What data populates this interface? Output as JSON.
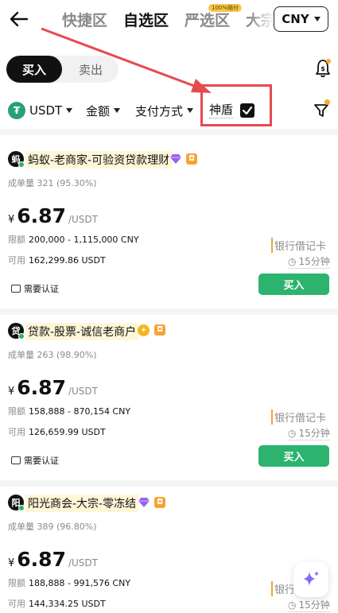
{
  "header": {
    "tabs": [
      {
        "label": "快捷区"
      },
      {
        "label": "自选区"
      },
      {
        "label": "严选区",
        "badge": "100%赔付"
      },
      {
        "label": "大宗"
      }
    ],
    "active_tab": "自选区",
    "currency": "CNY"
  },
  "trade_toggle": {
    "buy": "买入",
    "sell": "卖出"
  },
  "filters": {
    "asset": "USDT",
    "asset_icon": "tether-icon",
    "amount": "金额",
    "payment": "支付方式",
    "shield": "神盾",
    "shield_checked": true
  },
  "colors": {
    "accent_green": "#2cb36e",
    "highlight_red": "#e64950",
    "verified_orange": "#f6a430"
  },
  "listings": [
    {
      "avatar": "蚂",
      "name": "蚂蚁-老商家-可验资贷款理财",
      "badges": [
        "diamond-badge-icon",
        "shield-badge-icon"
      ],
      "stats": "成单量 321 (95.30%)",
      "currency_symbol": "¥",
      "price": "6.87",
      "price_unit": "/USDT",
      "limit_label": "限额",
      "limit": "200,000 - 1,115,000 CNY",
      "available_label": "可用",
      "available": "162,299.86 USDT",
      "verify": "需要认证",
      "payment": "银行借记卡",
      "time": "15分钟",
      "button": "买入"
    },
    {
      "avatar": "贷",
      "name": "贷款-股票-诚信老商户",
      "badges": [
        "gold-badge-icon",
        "shield-badge-icon"
      ],
      "stats": "成单量 263 (98.90%)",
      "currency_symbol": "¥",
      "price": "6.87",
      "price_unit": "/USDT",
      "limit_label": "限额",
      "limit": "158,888 - 870,154 CNY",
      "available_label": "可用",
      "available": "126,659.99 USDT",
      "verify": "需要认证",
      "payment": "银行借记卡",
      "time": "15分钟",
      "button": "买入"
    },
    {
      "avatar": "阳",
      "name": "阳光商会-大宗-零冻结",
      "badges": [
        "diamond-badge-icon",
        "shield-badge-icon"
      ],
      "stats": "成单量 389 (96.80%)",
      "currency_symbol": "¥",
      "price": "6.87",
      "price_unit": "/USDT",
      "limit_label": "限额",
      "limit": "188,888 - 991,576 CNY",
      "available_label": "可用",
      "available": "144,334.25 USDT",
      "payment": "银行",
      "time": "15分钟"
    }
  ]
}
